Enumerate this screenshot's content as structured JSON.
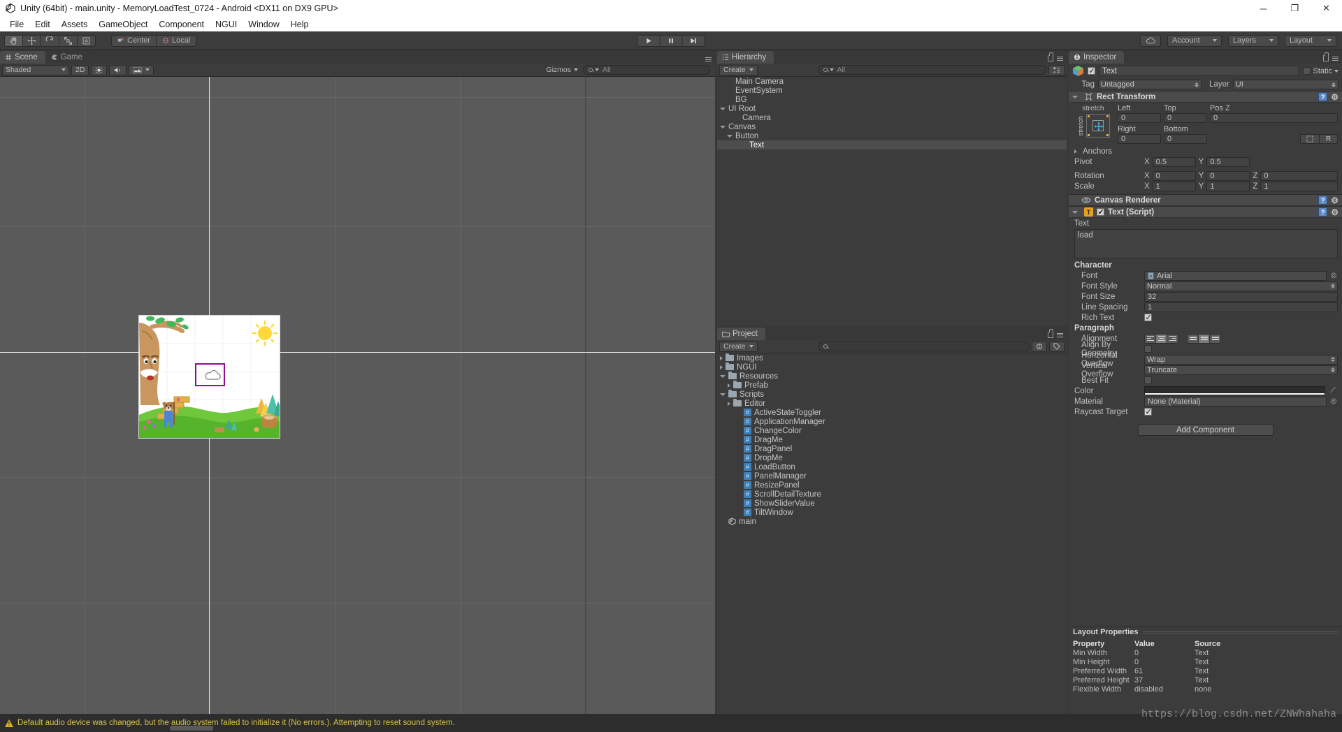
{
  "window": {
    "title": "Unity (64bit) - main.unity - MemoryLoadTest_0724 - Android <DX11 on DX9 GPU>",
    "minimize": "─",
    "maximize": "❐",
    "close": "✕"
  },
  "menubar": [
    "File",
    "Edit",
    "Assets",
    "GameObject",
    "Component",
    "NGUI",
    "Window",
    "Help"
  ],
  "toolbar": {
    "tools": [
      "hand-tool",
      "move-tool",
      "rotate-tool",
      "scale-tool",
      "rect-tool"
    ],
    "pivot_mode": "Center",
    "pivot_rotation": "Local",
    "play": "play-button",
    "pause": "pause-button",
    "step": "step-button",
    "cloud": "cloud-button",
    "account": "Account",
    "layers": "Layers",
    "layout": "Layout"
  },
  "scene": {
    "tabs": [
      {
        "label": "Scene",
        "active": true
      },
      {
        "label": "Game",
        "active": false
      }
    ],
    "draw_mode": "Shaded",
    "mode_2d": "2D",
    "lighting": "lighting-toggle",
    "audio": "audio-toggle",
    "effects": "effects-toggle",
    "gizmos": "Gizmos",
    "search_placeholder": "All"
  },
  "hierarchy": {
    "tab": "Hierarchy",
    "create": "Create",
    "search_placeholder": "All",
    "items": [
      {
        "label": "Main Camera",
        "depth": 1,
        "twirl": "none",
        "selected": false
      },
      {
        "label": "EventSystem",
        "depth": 1,
        "twirl": "none",
        "selected": false
      },
      {
        "label": "BG",
        "depth": 1,
        "twirl": "none",
        "selected": false
      },
      {
        "label": "UI Root",
        "depth": 0,
        "twirl": "open",
        "selected": false
      },
      {
        "label": "Camera",
        "depth": 2,
        "twirl": "none",
        "selected": false
      },
      {
        "label": "Canvas",
        "depth": 0,
        "twirl": "open",
        "selected": false
      },
      {
        "label": "Button",
        "depth": 1,
        "twirl": "open",
        "selected": false
      },
      {
        "label": "Text",
        "depth": 3,
        "twirl": "none",
        "selected": true
      }
    ]
  },
  "project": {
    "tab": "Project",
    "create": "Create",
    "search_placeholder": "",
    "items": [
      {
        "label": "Images",
        "depth": 0,
        "twirl": "closed",
        "icon": "folder"
      },
      {
        "label": "NGUI",
        "depth": 0,
        "twirl": "closed",
        "icon": "folder"
      },
      {
        "label": "Resources",
        "depth": 0,
        "twirl": "open",
        "icon": "folder"
      },
      {
        "label": "Prefab",
        "depth": 1,
        "twirl": "closed",
        "icon": "folder"
      },
      {
        "label": "Scripts",
        "depth": 0,
        "twirl": "open",
        "icon": "folder"
      },
      {
        "label": "Editor",
        "depth": 1,
        "twirl": "closed",
        "icon": "folder"
      },
      {
        "label": "ActiveStateToggler",
        "depth": 2,
        "twirl": "none",
        "icon": "csharp"
      },
      {
        "label": "ApplicationManager",
        "depth": 2,
        "twirl": "none",
        "icon": "csharp"
      },
      {
        "label": "ChangeColor",
        "depth": 2,
        "twirl": "none",
        "icon": "csharp"
      },
      {
        "label": "DragMe",
        "depth": 2,
        "twirl": "none",
        "icon": "csharp"
      },
      {
        "label": "DragPanel",
        "depth": 2,
        "twirl": "none",
        "icon": "csharp"
      },
      {
        "label": "DropMe",
        "depth": 2,
        "twirl": "none",
        "icon": "csharp"
      },
      {
        "label": "LoadButton",
        "depth": 2,
        "twirl": "none",
        "icon": "csharp"
      },
      {
        "label": "PanelManager",
        "depth": 2,
        "twirl": "none",
        "icon": "csharp"
      },
      {
        "label": "ResizePanel",
        "depth": 2,
        "twirl": "none",
        "icon": "csharp"
      },
      {
        "label": "ScrollDetailTexture",
        "depth": 2,
        "twirl": "none",
        "icon": "csharp"
      },
      {
        "label": "ShowSliderValue",
        "depth": 2,
        "twirl": "none",
        "icon": "csharp"
      },
      {
        "label": "TiltWindow",
        "depth": 2,
        "twirl": "none",
        "icon": "csharp"
      },
      {
        "label": "main",
        "depth": 0,
        "twirl": "none",
        "icon": "unity"
      }
    ]
  },
  "inspector": {
    "tab": "Inspector",
    "object_name": "Text",
    "object_enabled": true,
    "static_label": "Static",
    "tag_label": "Tag",
    "tag_value": "Untagged",
    "layer_label": "Layer",
    "layer_value": "UI",
    "rect_transform": {
      "title": "Rect Transform",
      "anchor_preset": "stretch",
      "anchor_preset_v": "stretch",
      "left_label": "Left",
      "left": "0",
      "top_label": "Top",
      "top": "0",
      "posz_label": "Pos Z",
      "posz": "0",
      "right_label": "Right",
      "right": "0",
      "bottom_label": "Bottom",
      "bottom": "0",
      "blueprint_label": "R",
      "anchors_label": "Anchors",
      "pivot_label": "Pivot",
      "pivot_x": "0.5",
      "pivot_y": "0.5",
      "rotation_label": "Rotation",
      "rot_x": "0",
      "rot_y": "0",
      "rot_z": "0",
      "scale_label": "Scale",
      "scale_x": "1",
      "scale_y": "1",
      "scale_z": "1"
    },
    "canvas_renderer": {
      "title": "Canvas Renderer"
    },
    "text_script": {
      "title": "Text (Script)",
      "enabled": true,
      "text_label": "Text",
      "text_value": "load",
      "character_label": "Character",
      "font_label": "Font",
      "font_value": "Arial",
      "font_style_label": "Font Style",
      "font_style_value": "Normal",
      "font_size_label": "Font Size",
      "font_size_value": "32",
      "line_spacing_label": "Line Spacing",
      "line_spacing_value": "1",
      "rich_text_label": "Rich Text",
      "rich_text_value": true,
      "paragraph_label": "Paragraph",
      "alignment_label": "Alignment",
      "align_by_geometry_label": "Align By Geometry",
      "align_by_geometry_value": false,
      "h_overflow_label": "Horizontal Overflow",
      "h_overflow_value": "Wrap",
      "v_overflow_label": "Vertical Overflow",
      "v_overflow_value": "Truncate",
      "best_fit_label": "Best Fit",
      "best_fit_value": false,
      "color_label": "Color",
      "material_label": "Material",
      "material_value": "None (Material)",
      "raycast_label": "Raycast Target",
      "raycast_value": true
    },
    "add_component": "Add Component",
    "layout_properties": {
      "title": "Layout Properties",
      "headers": [
        "Property",
        "Value",
        "Source"
      ],
      "rows": [
        {
          "property": "Min Width",
          "value": "0",
          "source": "Text"
        },
        {
          "property": "Min Height",
          "value": "0",
          "source": "Text"
        },
        {
          "property": "Preferred Width",
          "value": "61",
          "source": "Text"
        },
        {
          "property": "Preferred Height",
          "value": "37",
          "source": "Text"
        },
        {
          "property": "Flexible Width",
          "value": "disabled",
          "source": "none"
        }
      ]
    }
  },
  "statusbar": {
    "message": "Default audio device was changed, but the audio system failed to initialize it (No errors.). Attempting to reset sound system.",
    "watermark": "https://blog.csdn.net/ZNWhahaha"
  }
}
